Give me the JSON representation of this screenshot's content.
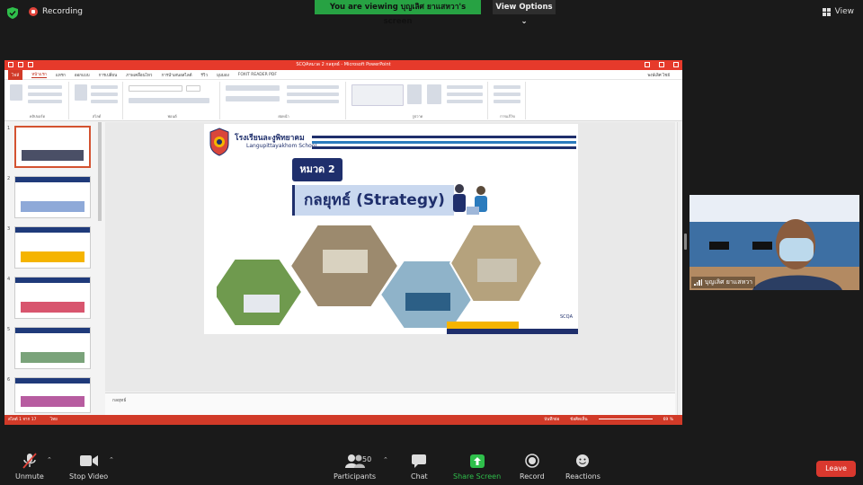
{
  "topbar": {
    "recording_label": "Recording",
    "viewing_banner": "You are viewing บุญเลิศ ยาแสหวา's screen",
    "view_options_label": "View Options",
    "view_label": "View"
  },
  "ppt": {
    "window_title": "SCQAหมวด 2 กลยุทธ์ - Microsoft PowerPoint",
    "tabs": [
      "ไฟล์",
      "หน้าแรก",
      "แทรก",
      "ออกแบบ",
      "การเปลี่ยน",
      "ภาพเคลื่อนไหว",
      "การนำเสนอสไลด์",
      "รีวิว",
      "มุมมอง",
      "FOXIT READER PDF"
    ],
    "share_user": "พงษ์เลิศ ไชย์",
    "group_labels": [
      "คลิปบอร์ด",
      "สไลด์",
      "ฟอนต์",
      "ย่อหน้า",
      "รูปวาด",
      "การแก้ไข"
    ],
    "thumb_numbers": [
      "1",
      "2",
      "3",
      "4",
      "5",
      "6"
    ],
    "notes_text": "กลยุทธ์",
    "status_left": "สไลด์ 1 จาก 17",
    "status_lang": "ไทย",
    "status_notes": "บันทึกย่อ",
    "status_comments": "ข้อคิดเห็น",
    "zoom": "69 %"
  },
  "slide": {
    "school_th": "โรงเรียนละงูพิทยาคม",
    "school_en": "Langupittayakhom School",
    "chapter": "หมวด 2",
    "title": "กลยุทธ์ (Strategy)",
    "mark": "SCQA"
  },
  "video": {
    "participant_name": "บุญเลิศ ยาแสหวา"
  },
  "controls": {
    "unmute": "Unmute",
    "stop_video": "Stop Video",
    "participants": "Participants",
    "participants_count": "50",
    "chat": "Chat",
    "share_screen": "Share Screen",
    "record": "Record",
    "reactions": "Reactions",
    "leave": "Leave"
  },
  "colors": {
    "zoom_green": "#27a243",
    "leave_red": "#d9382e",
    "ppt_red": "#d13a28",
    "slide_navy": "#1f2f6c"
  }
}
